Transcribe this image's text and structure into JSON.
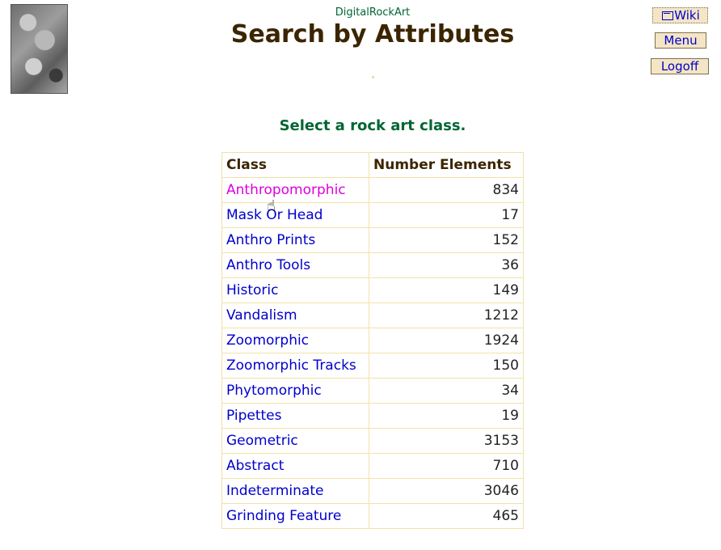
{
  "app_name": "DigitalRockArt",
  "page_title": "Search by Attributes",
  "nav": {
    "wiki_label": "Wiki",
    "menu_label": "Menu",
    "logoff_label": "Logoff"
  },
  "prompt": "Select a rock art class.",
  "table": {
    "headers": [
      "Class",
      "Number Elements"
    ],
    "rows": [
      {
        "class": "Anthropomorphic",
        "count": "834"
      },
      {
        "class": "Mask Or Head",
        "count": "17"
      },
      {
        "class": "Anthro Prints",
        "count": "152"
      },
      {
        "class": "Anthro Tools",
        "count": "36"
      },
      {
        "class": "Historic",
        "count": "149"
      },
      {
        "class": "Vandalism",
        "count": "1212"
      },
      {
        "class": "Zoomorphic",
        "count": "1924"
      },
      {
        "class": "Zoomorphic Tracks",
        "count": "150"
      },
      {
        "class": "Phytomorphic",
        "count": "34"
      },
      {
        "class": "Pipettes",
        "count": "19"
      },
      {
        "class": "Geometric",
        "count": "3153"
      },
      {
        "class": "Abstract",
        "count": "710"
      },
      {
        "class": "Indeterminate",
        "count": "3046"
      },
      {
        "class": "Grinding Feature",
        "count": "465"
      }
    ]
  },
  "colors": {
    "link": "#0000cc",
    "link_hover": "#dd00dd",
    "title": "#3b2500",
    "accent_green": "#006633",
    "table_border": "#f2e2a7",
    "button_bg": "#f4e6c5"
  },
  "icons": {
    "wiki": "wiki-icon",
    "cursor": "hand-pointer-icon"
  }
}
